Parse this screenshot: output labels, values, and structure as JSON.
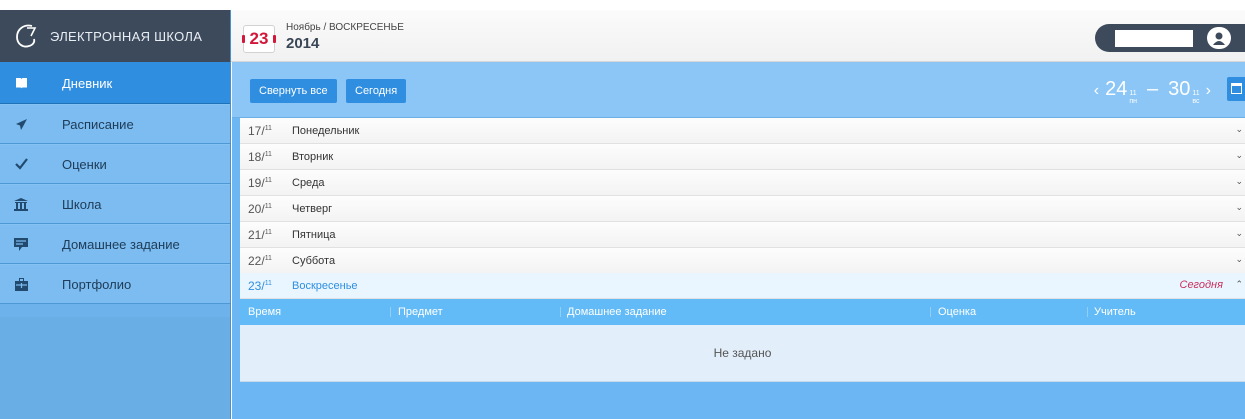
{
  "brand": {
    "title": "ЭЛЕКТРОННАЯ ШКОЛА"
  },
  "header": {
    "day": "23",
    "month_weekday": "Ноябрь / ВОСКРЕСЕНЬЕ",
    "year": "2014"
  },
  "sidebar": {
    "items": [
      {
        "label": "Дневник",
        "icon": "book-icon"
      },
      {
        "label": "Расписание",
        "icon": "paper-plane-icon"
      },
      {
        "label": "Оценки",
        "icon": "checkmark-icon"
      },
      {
        "label": "Школа",
        "icon": "school-building-icon"
      },
      {
        "label": "Домашнее задание",
        "icon": "homework-icon"
      },
      {
        "label": "Портфолио",
        "icon": "briefcase-icon"
      }
    ],
    "active_index": 0
  },
  "toolbar": {
    "collapse_label": "Свернуть все",
    "today_label": "Сегодня",
    "week_start": "24",
    "week_start_month": "11",
    "week_start_day": "пн",
    "week_end": "30",
    "week_end_month": "11",
    "week_end_day": "вс",
    "prev_arrow": "‹",
    "next_arrow": "›",
    "dash": "–"
  },
  "days": [
    {
      "date": "17/",
      "month": "11",
      "weekday": "Понедельник"
    },
    {
      "date": "18/",
      "month": "11",
      "weekday": "Вторник"
    },
    {
      "date": "19/",
      "month": "11",
      "weekday": "Среда"
    },
    {
      "date": "20/",
      "month": "11",
      "weekday": "Четверг"
    },
    {
      "date": "21/",
      "month": "11",
      "weekday": "Пятница"
    },
    {
      "date": "22/",
      "month": "11",
      "weekday": "Суббота"
    },
    {
      "date": "23/",
      "month": "11",
      "weekday": "Воскресенье",
      "tag": "Сегодня"
    }
  ],
  "table": {
    "columns": [
      "Время",
      "Предмет",
      "Домашнее задание",
      "Оценка",
      "Учитель"
    ],
    "empty_text": "Не задано"
  },
  "colors": {
    "accent": "#2f8ee0",
    "sidebar_bg": "#6db2ea",
    "brand_bg": "#3d4a5c",
    "today_tag": "#c9305d",
    "date_red": "#d2173a"
  }
}
